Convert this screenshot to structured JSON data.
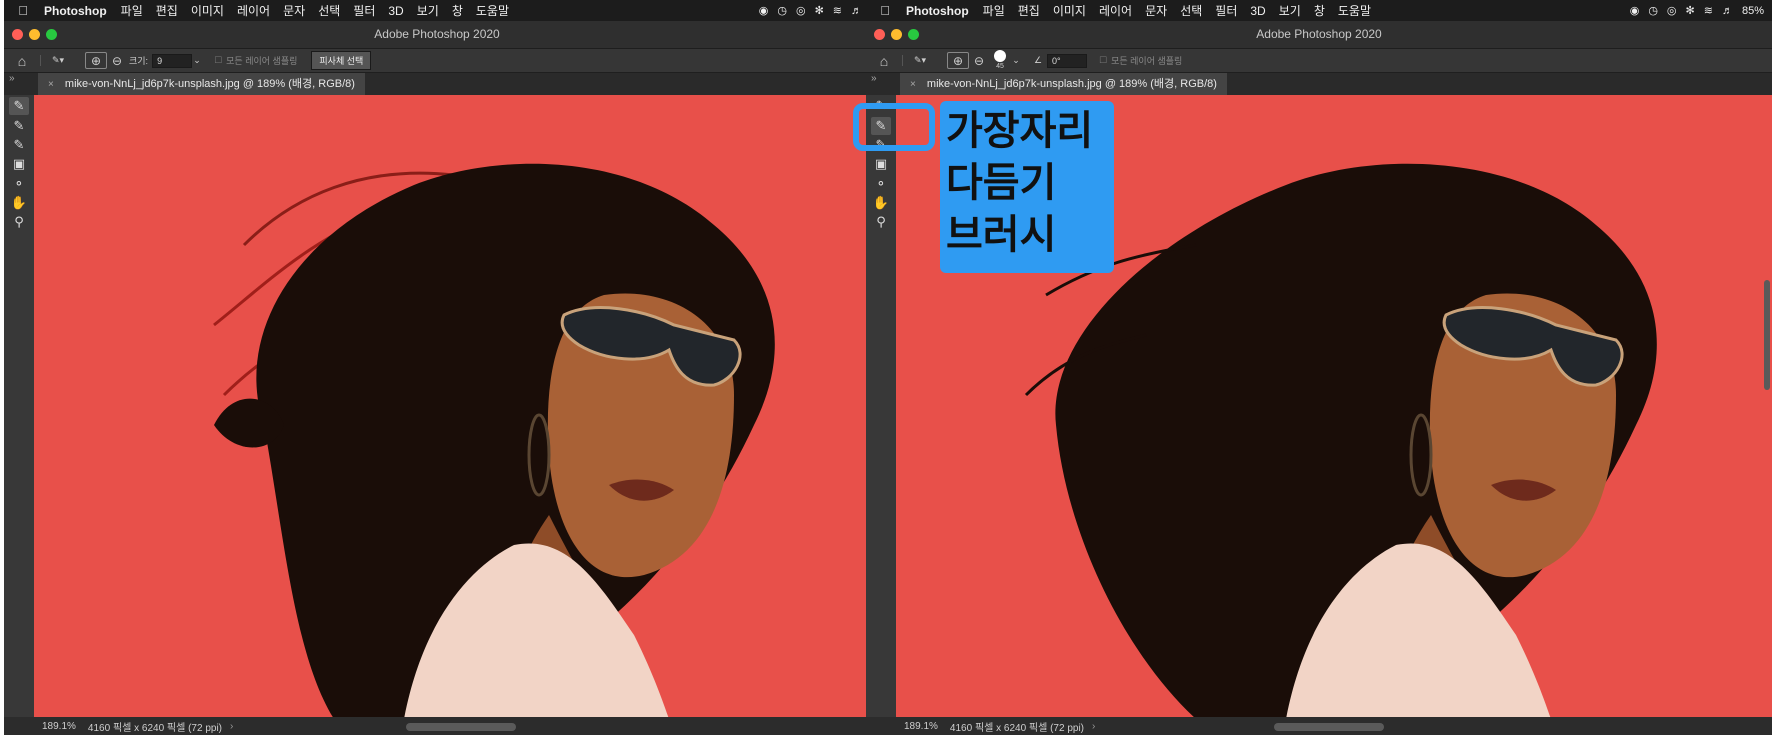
{
  "menubar": {
    "app_name": "Photoshop",
    "items": [
      "파일",
      "편집",
      "이미지",
      "레이어",
      "문자",
      "선택",
      "필터",
      "3D",
      "보기",
      "창",
      "도움말"
    ],
    "right_battery": "85%"
  },
  "window": {
    "title": "Adobe Photoshop 2020"
  },
  "options_left": {
    "size_label": "크기:",
    "size_value": "9",
    "sample_label": "모든 레이어 샘플링",
    "select_subject": "피사체 선택"
  },
  "options_right": {
    "brush_size": "45",
    "angle_value": "0°",
    "sample_label": "모든 레이어 샘플링"
  },
  "document": {
    "tab": "mike-von-NnLj_jd6p7k-unsplash.jpg @ 189% (배경, RGB/8)"
  },
  "statusbar": {
    "zoom": "189.1%",
    "info": "4160 픽셀 x 6240 픽셀 (72 ppi)"
  },
  "callout": {
    "line1": "가장자리",
    "line2": "다듬기",
    "line3": "브러시"
  },
  "colors": {
    "background_red": "#e8504a",
    "callout_blue": "#2f9bf2"
  }
}
